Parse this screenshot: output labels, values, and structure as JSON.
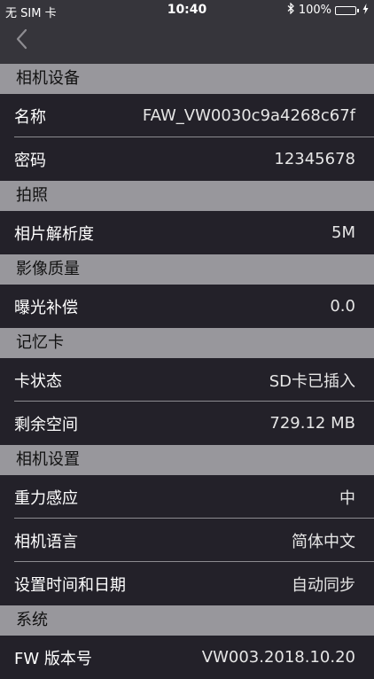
{
  "status_bar": {
    "carrier": "无 SIM 卡",
    "time": "10:40",
    "battery_percent": "100%",
    "battery_level": 1.0
  },
  "nav": {
    "back_icon": "chevron-left-icon"
  },
  "sections": [
    {
      "title": "相机设备",
      "rows": [
        {
          "label": "名称",
          "value": "FAW_VW0030c9a4268c67f"
        },
        {
          "label": "密码",
          "value": "12345678"
        }
      ]
    },
    {
      "title": "拍照",
      "rows": [
        {
          "label": "相片解析度",
          "value": "5M"
        }
      ]
    },
    {
      "title": "影像质量",
      "rows": [
        {
          "label": "曝光补偿",
          "value": "0.0"
        }
      ]
    },
    {
      "title": "记忆卡",
      "rows": [
        {
          "label": "卡状态",
          "value": "SD卡已插入"
        },
        {
          "label": "剩余空间",
          "value": "729.12 MB"
        }
      ]
    },
    {
      "title": "相机设置",
      "rows": [
        {
          "label": "重力感应",
          "value": "中"
        },
        {
          "label": "相机语言",
          "value": "简体中文"
        },
        {
          "label": "设置时间和日期",
          "value": "自动同步"
        }
      ]
    },
    {
      "title": "系统",
      "rows": [
        {
          "label": "FW 版本号",
          "value": "VW003.2018.10.20"
        }
      ]
    }
  ]
}
